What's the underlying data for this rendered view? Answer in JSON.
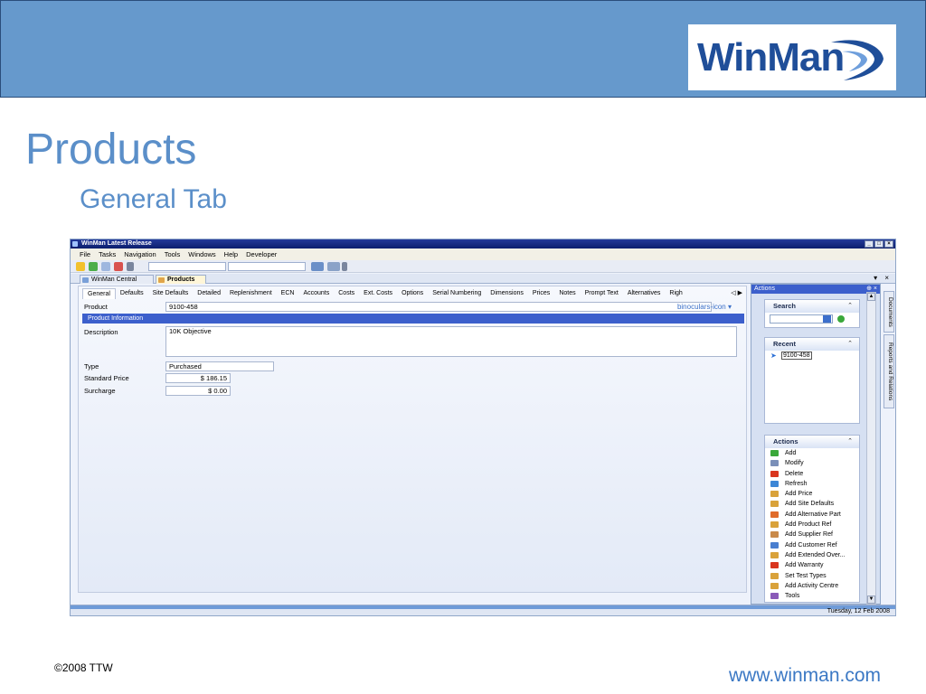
{
  "slide": {
    "logo_text": "WinMan",
    "title": "Products",
    "subtitle": "General Tab",
    "footer_copyright": "©2008 TTW",
    "footer_url": "www.winman.com"
  },
  "window": {
    "title": "WinMan Latest Release",
    "controls": [
      "_",
      "□",
      "×"
    ]
  },
  "menu": [
    "File",
    "Tasks",
    "Navigation",
    "Tools",
    "Windows",
    "Help",
    "Developer"
  ],
  "doc_tabs": [
    {
      "label": "WinMan Central",
      "active": false
    },
    {
      "label": "Products",
      "active": true
    }
  ],
  "doc_tab_controls": "▾ ×",
  "subtabs": [
    "General",
    "Defaults",
    "Site Defaults",
    "Detailed",
    "Replenishment",
    "ECN",
    "Accounts",
    "Costs",
    "Ext. Costs",
    "Options",
    "Serial Numbering",
    "Dimensions",
    "Prices",
    "Notes",
    "Prompt Text",
    "Alternatives",
    "Righ"
  ],
  "subtab_nav": "◁ ▶",
  "form": {
    "product_label": "Product",
    "product_value": "9100-458",
    "lookup_icon": "binoculars-icon ▾",
    "section_header": "Product Information",
    "description_label": "Description",
    "description_value": "10K Objective",
    "type_label": "Type",
    "type_value": "Purchased",
    "standard_price_label": "Standard Price",
    "standard_price_value": "$ 186.15",
    "surcharge_label": "Surcharge",
    "surcharge_value": "$ 0.00"
  },
  "actions_pane": {
    "header": "Actions",
    "header_pin": "⊕ ×",
    "search": {
      "title": "Search",
      "chevron": "⌃"
    },
    "recent": {
      "title": "Recent",
      "chevron": "⌃",
      "items": [
        "9100-458"
      ]
    },
    "actions": {
      "title": "Actions",
      "chevron": "⌃",
      "items": [
        {
          "label": "Add",
          "color": "#3aa83a"
        },
        {
          "label": "Modify",
          "color": "#7a8fb8"
        },
        {
          "label": "Delete",
          "color": "#d9361e"
        },
        {
          "label": "Refresh",
          "color": "#3c86d6"
        },
        {
          "label": "Add Price",
          "color": "#d9a23a"
        },
        {
          "label": "Add Site Defaults",
          "color": "#d9a23a"
        },
        {
          "label": "Add Alternative Part",
          "color": "#e06b2a"
        },
        {
          "label": "Add Product Ref",
          "color": "#d9a23a"
        },
        {
          "label": "Add Supplier Ref",
          "color": "#c98a4a"
        },
        {
          "label": "Add Customer Ref",
          "color": "#4a7fd0"
        },
        {
          "label": "Add  Extended  Over...",
          "color": "#d9a23a"
        },
        {
          "label": "Add Warranty",
          "color": "#d9361e"
        },
        {
          "label": "Set Test Types",
          "color": "#d9a23a"
        },
        {
          "label": "Add Activity Centre",
          "color": "#d9a23a"
        },
        {
          "label": "Tools",
          "color": "#8a5ab8"
        }
      ]
    }
  },
  "side_tabs": [
    "Documents",
    "Reports and Relations"
  ],
  "status": {
    "date": "Tuesday, 12 Feb 2008"
  }
}
